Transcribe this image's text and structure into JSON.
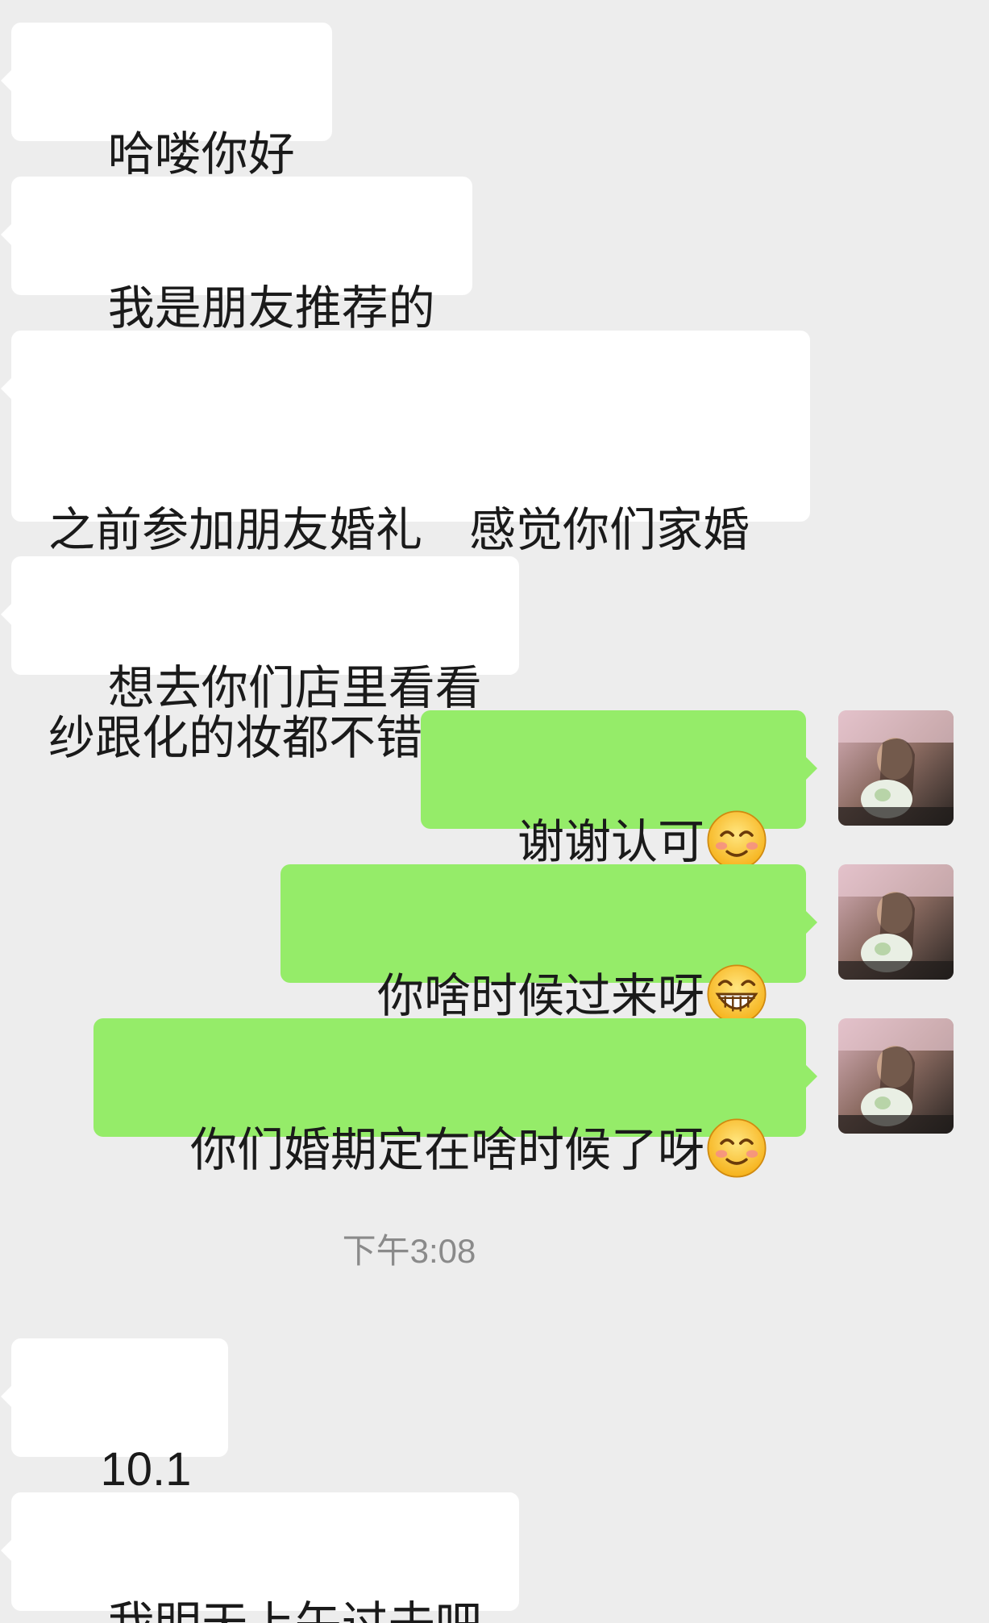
{
  "messages": [
    {
      "side": "incoming",
      "text": "哈喽你好"
    },
    {
      "side": "incoming",
      "text": "我是朋友推荐的"
    },
    {
      "side": "incoming",
      "text_line1": "之前参加朋友婚礼　感觉你们家婚",
      "text_line2": "纱跟化的妆都不错"
    },
    {
      "side": "incoming",
      "text": "想去你们店里看看"
    },
    {
      "side": "outgoing",
      "text": "谢谢认可",
      "emoji": "smiling-blush-emoji"
    },
    {
      "side": "outgoing",
      "text": "你啥时候过来呀",
      "emoji": "grinning-emoji"
    },
    {
      "side": "outgoing",
      "text": "你们婚期定在啥时候了呀",
      "emoji": "smiling-blush-emoji"
    },
    {
      "side": "incoming",
      "text": "10.1"
    },
    {
      "side": "incoming",
      "text": "我明天上午过去吧"
    }
  ],
  "timestamp": "下午3:08",
  "avatar": {
    "icon": "user-avatar-photo"
  },
  "colors": {
    "background": "#ededed",
    "incoming_bubble": "#ffffff",
    "outgoing_bubble": "#95ec69",
    "timestamp_text": "#8a8a8a"
  }
}
